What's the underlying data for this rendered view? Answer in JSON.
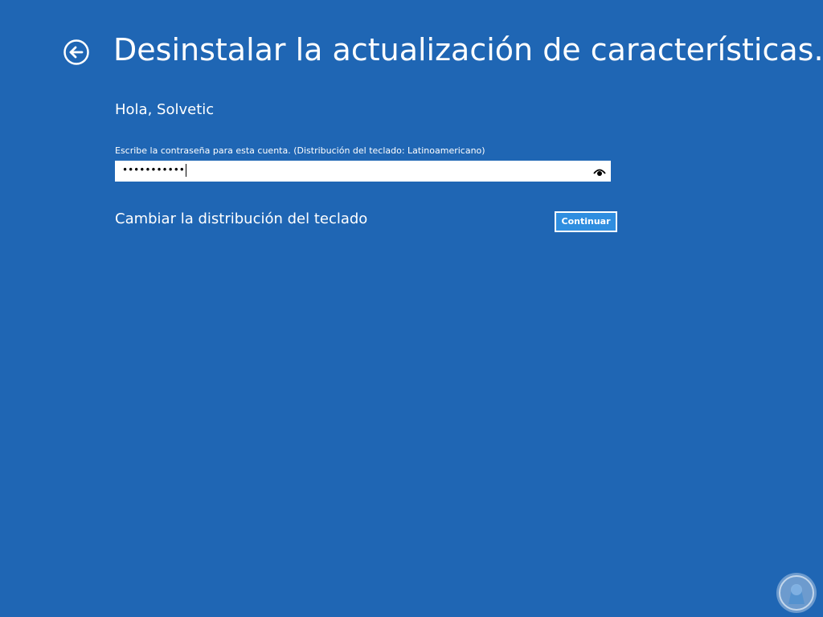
{
  "header": {
    "title": "Desinstalar la actualización de características..."
  },
  "account": {
    "greeting": "Hola, Solvetic",
    "prompt": "Escribe la contraseña para esta cuenta. (Distribución del teclado: Latinoamericano)",
    "password_masked": "•••••••••••"
  },
  "actions": {
    "change_layout_label": "Cambiar la distribución del teclado",
    "continue_label": "Continuar"
  },
  "colors": {
    "background": "#1f66b4",
    "button": "#2f8ee0",
    "text": "#ffffff"
  },
  "icons": {
    "back": "back-arrow-circle-icon",
    "reveal": "eye-icon",
    "watermark": "solvetic-logo"
  }
}
